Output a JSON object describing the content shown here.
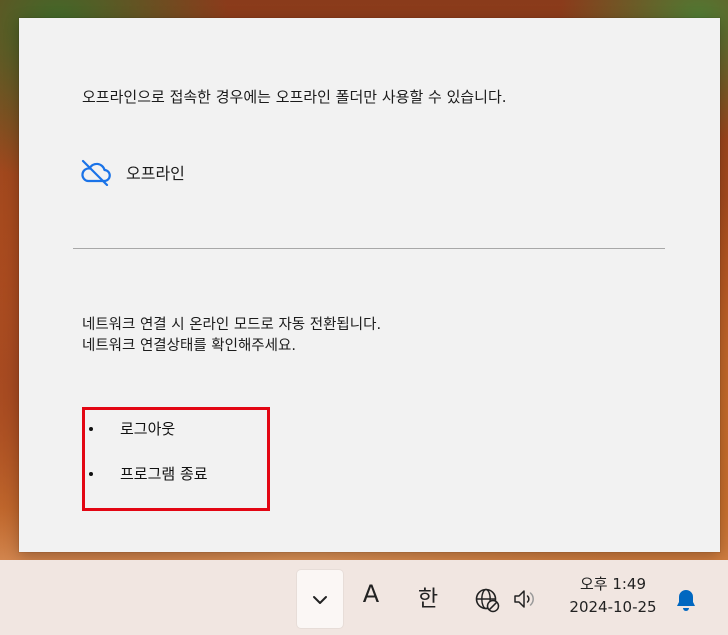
{
  "popup": {
    "info_text": "오프라인으로 접속한 경우에는 오프라인 폴더만 사용할 수 있습니다.",
    "status_icon": "cloud-offline-icon",
    "status_label": "오프라인",
    "network_message_line1": "네트워크 연결 시 온라인 모드로 자동 전환됩니다.",
    "network_message_line2": "네트워크 연결상태를 확인해주세요.",
    "menu_items": [
      {
        "label": "로그아웃"
      },
      {
        "label": "프로그램 종료"
      }
    ],
    "highlight_color": "#e30613",
    "accent_color": "#1a73e8"
  },
  "taskbar": {
    "chevron_icon": "chevron-down-icon",
    "ime_mode_label": "A",
    "ime_language_label": "한",
    "network_icon": "globe-blocked-icon",
    "volume_icon": "speaker-icon",
    "clock_time": "오후 1:49",
    "clock_date": "2024-10-25",
    "notification_icon": "bell-icon",
    "notification_color": "#0067c0"
  }
}
